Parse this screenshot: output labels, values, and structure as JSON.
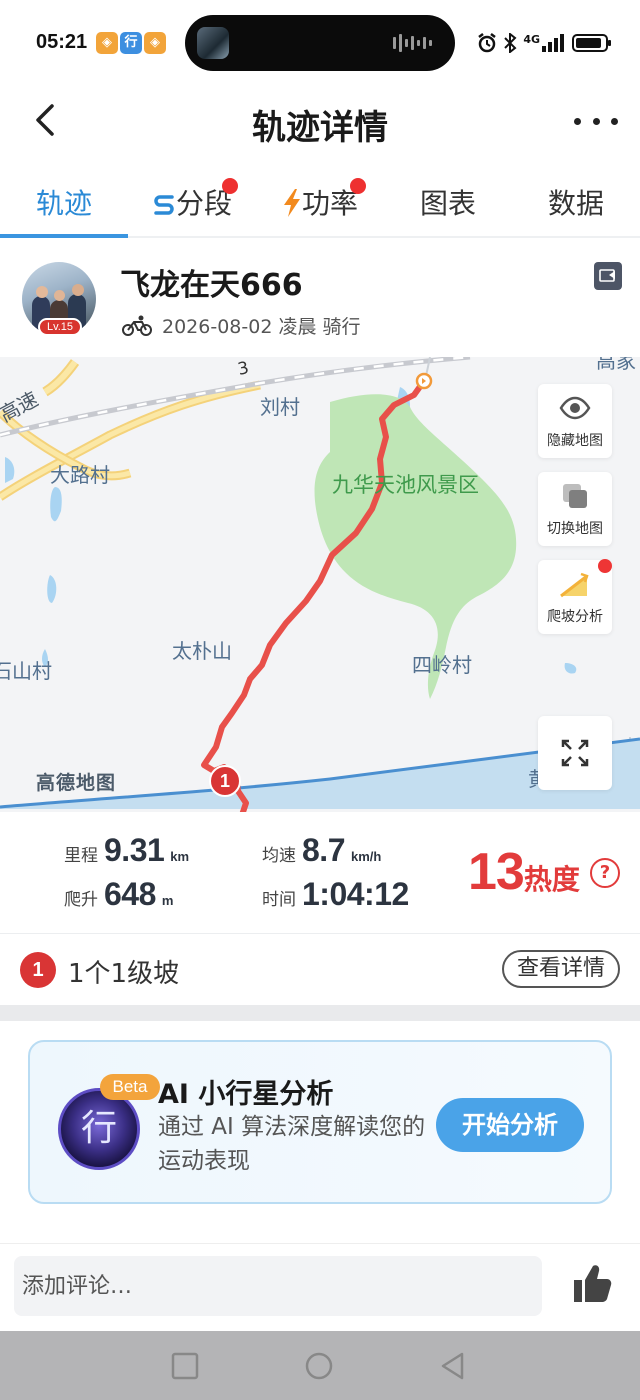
{
  "status_bar": {
    "time": "05:21",
    "app_icons": [
      {
        "name": "app-icon-1",
        "glyph": "◈",
        "color": "#f2a43a"
      },
      {
        "name": "app-icon-2",
        "glyph": "行",
        "color": "#3d8fe0"
      },
      {
        "name": "app-icon-3",
        "glyph": "◈",
        "color": "#f2a43a"
      }
    ],
    "network": "4G",
    "icons": [
      "alarm-icon",
      "bluetooth-icon",
      "signal-icon",
      "battery-icon"
    ]
  },
  "header": {
    "title": "轨迹详情",
    "back_icon": "back-chevron-icon",
    "more_icon": "more-dots-icon"
  },
  "tabs": [
    {
      "label": "轨迹",
      "active": true,
      "dot": false,
      "icon": ""
    },
    {
      "label": "分段",
      "active": false,
      "dot": true,
      "icon": "segment-icon"
    },
    {
      "label": "功率",
      "active": false,
      "dot": true,
      "icon": "lightning-icon"
    },
    {
      "label": "图表",
      "active": false,
      "dot": false,
      "icon": ""
    },
    {
      "label": "数据",
      "active": false,
      "dot": false,
      "icon": ""
    }
  ],
  "profile": {
    "username": "飞龙在天666",
    "level": "Lv.15",
    "date_text": "2026-08-02 凌晨 骑行",
    "sport_icon": "bicycle-icon",
    "share_icon": "share-card-icon"
  },
  "map": {
    "labels": {
      "highway": "高速",
      "highway_no": "3",
      "liucun": "刘村",
      "dalucun": "大路村",
      "scenic": "九华天池风景区",
      "taipushan": "太朴山",
      "shishancun": "石山村",
      "silingcun": "四岭村",
      "gaojia": "高家",
      "huang": "黄"
    },
    "buttons": {
      "hide_map": "隐藏地图",
      "switch_map": "切换地图",
      "climb_analysis": "爬坡分析"
    },
    "watermark": "高德地图",
    "start_marker": "1",
    "route_color": "#e8504a",
    "park_color": "#bfe6b6",
    "river_color": "#4a8fd0"
  },
  "stats": {
    "distance": {
      "label": "里程",
      "value": "9.31",
      "unit": "km"
    },
    "avg_speed": {
      "label": "均速",
      "value": "8.7",
      "unit": "km/h"
    },
    "climb": {
      "label": "爬升",
      "value": "648",
      "unit": "m"
    },
    "duration": {
      "label": "时间",
      "value": "1:04:12",
      "unit": ""
    },
    "heat": {
      "value": "13",
      "label": "热度"
    },
    "help": "?"
  },
  "climb_summary": {
    "badge": "1",
    "text": "1个1级坡",
    "button": "查看详情"
  },
  "ai_card": {
    "beta": "Beta",
    "logo_text": "行",
    "title": "AI 小行星分析",
    "description": "通过 AI 算法深度解读您的运动表现",
    "button": "开始分析"
  },
  "comment": {
    "placeholder": "添加评论…",
    "like_icon": "thumbs-up-icon"
  },
  "nav_bar": {
    "buttons": [
      "recent-apps-icon",
      "home-icon",
      "back-icon"
    ]
  },
  "colors": {
    "accent": "#2b8ad6",
    "heat": "#e23b3b",
    "badge_red": "#d93535"
  }
}
